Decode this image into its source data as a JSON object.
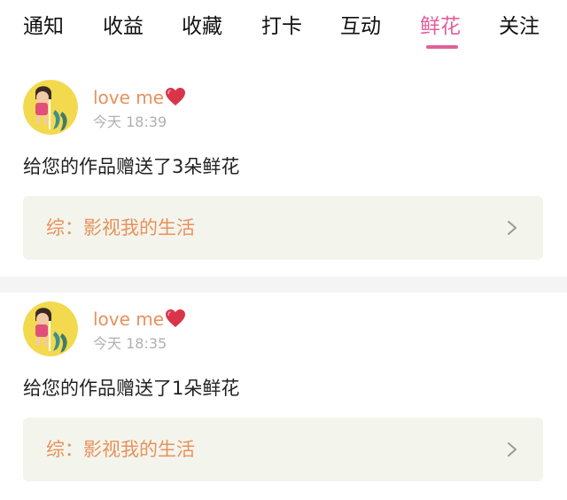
{
  "tabs": [
    {
      "label": "通知"
    },
    {
      "label": "收益"
    },
    {
      "label": "收藏"
    },
    {
      "label": "打卡"
    },
    {
      "label": "互动"
    },
    {
      "label": "鲜花",
      "active": true
    },
    {
      "label": "关注"
    }
  ],
  "colors": {
    "accent_pink": "#e0609a",
    "username_orange": "#e8915c",
    "card_background": "#f3f5ec",
    "time_gray": "#b0b0b0"
  },
  "notifications": [
    {
      "username": "love me",
      "username_icon": "heart-icon",
      "time": "今天 18:39",
      "message": "给您的作品赠送了3朵鲜花",
      "work_label": "综：影视我的生活",
      "link_icon": "chevron-right-icon"
    },
    {
      "username": "love me",
      "username_icon": "heart-icon",
      "time": "今天 18:35",
      "message": "给您的作品赠送了1朵鲜花",
      "work_label": "综：影视我的生活",
      "link_icon": "chevron-right-icon"
    }
  ]
}
